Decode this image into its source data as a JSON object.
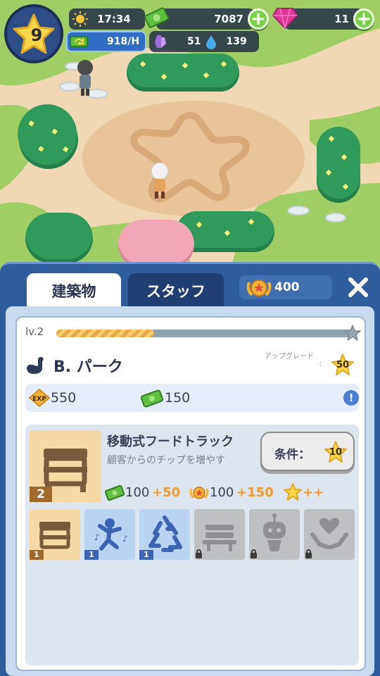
{
  "hud": {
    "level": "9",
    "time": "17:34",
    "money": "7087",
    "gems": "11",
    "income_rate": "918/H",
    "purple_resource": "51",
    "water_resource": "139"
  },
  "panel": {
    "tabs": [
      {
        "label": "建築物",
        "active": true
      },
      {
        "label": "スタッフ",
        "active": false
      }
    ],
    "medal_count": "400",
    "level_label": "lv.2",
    "level_progress": 0.33,
    "building_name": "B. パーク",
    "upgrade_label": "アップグレード",
    "upgrade_colon": ":",
    "upgrade_cost": "50",
    "exp_value": "550",
    "money_value": "150",
    "item": {
      "title": "移動式フードトラック",
      "description": "顧客からのチップを増やす",
      "level": "2",
      "condition_label": "条件：",
      "condition_level": "10",
      "reward_money": "100",
      "reward_money_bonus": "+50",
      "reward_medal": "100",
      "reward_medal_bonus": "+150",
      "reward_star_bonus": "++"
    },
    "slots": [
      {
        "icon": "food-truck-icon",
        "level": "1",
        "unlocked": true
      },
      {
        "icon": "dancer-icon",
        "level": "1",
        "unlocked": true
      },
      {
        "icon": "recycle-icon",
        "level": "1",
        "unlocked": true
      },
      {
        "icon": "bench-icon",
        "locked": true
      },
      {
        "icon": "robot-icon",
        "locked": true
      },
      {
        "icon": "heart-hands-icon",
        "locked": true
      }
    ]
  },
  "colors": {
    "panel_blue": "#2f5c9c",
    "accent_orange": "#f19a2e",
    "gem_pink": "#e0379b",
    "money_green": "#6cc24a"
  }
}
